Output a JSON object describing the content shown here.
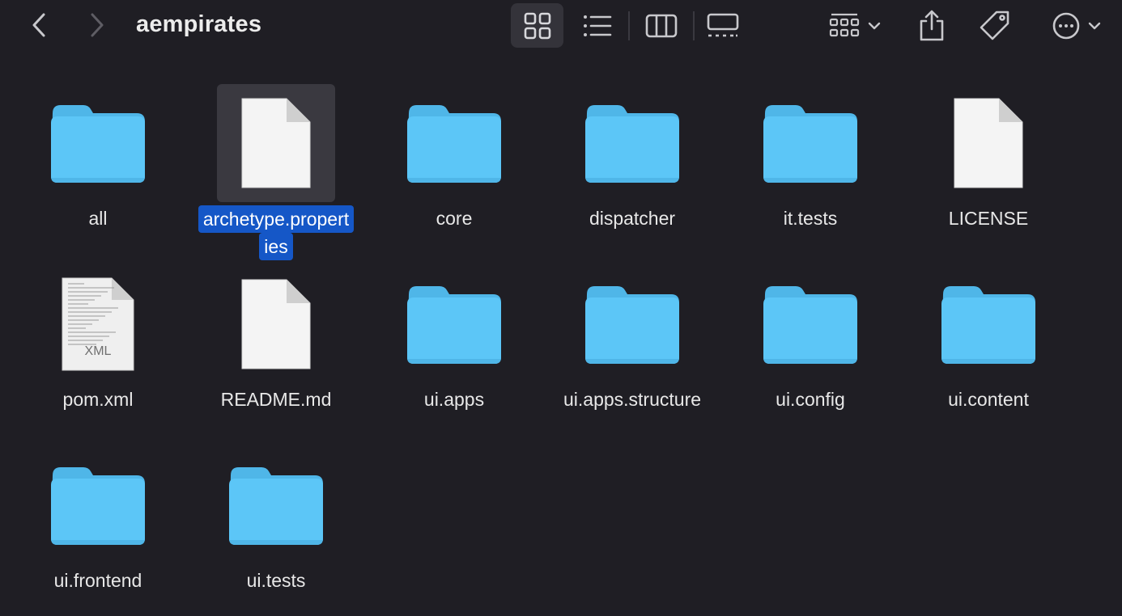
{
  "toolbar": {
    "title": "aempirates",
    "back_icon": "chevron-left-icon",
    "forward_icon": "chevron-right-icon",
    "view_modes": [
      "icon-view-icon",
      "list-view-icon",
      "column-view-icon",
      "gallery-view-icon"
    ],
    "active_view": "icon",
    "group_icon": "group-by-icon",
    "share_icon": "share-icon",
    "tag_icon": "tag-icon",
    "more_icon": "ellipsis-circle-icon"
  },
  "items": [
    {
      "name": "all",
      "type": "folder"
    },
    {
      "name": "archetype.properties",
      "line1": "archetype.propert",
      "line2": "ies",
      "type": "file",
      "selected": true
    },
    {
      "name": "core",
      "type": "folder"
    },
    {
      "name": "dispatcher",
      "type": "folder"
    },
    {
      "name": "it.tests",
      "type": "folder"
    },
    {
      "name": "LICENSE",
      "type": "file"
    },
    {
      "name": "pom.xml",
      "type": "xml",
      "badge": "XML"
    },
    {
      "name": "README.md",
      "type": "file"
    },
    {
      "name": "ui.apps",
      "type": "folder"
    },
    {
      "name": "ui.apps.structure",
      "type": "folder"
    },
    {
      "name": "ui.config",
      "type": "folder"
    },
    {
      "name": "ui.content",
      "type": "folder"
    },
    {
      "name": "ui.frontend",
      "type": "folder"
    },
    {
      "name": "ui.tests",
      "type": "folder"
    }
  ],
  "colors": {
    "background": "#1f1e24",
    "folder": "#5cc6f7",
    "folder_tab": "#4fb6e8",
    "selection": "#1557c7"
  }
}
